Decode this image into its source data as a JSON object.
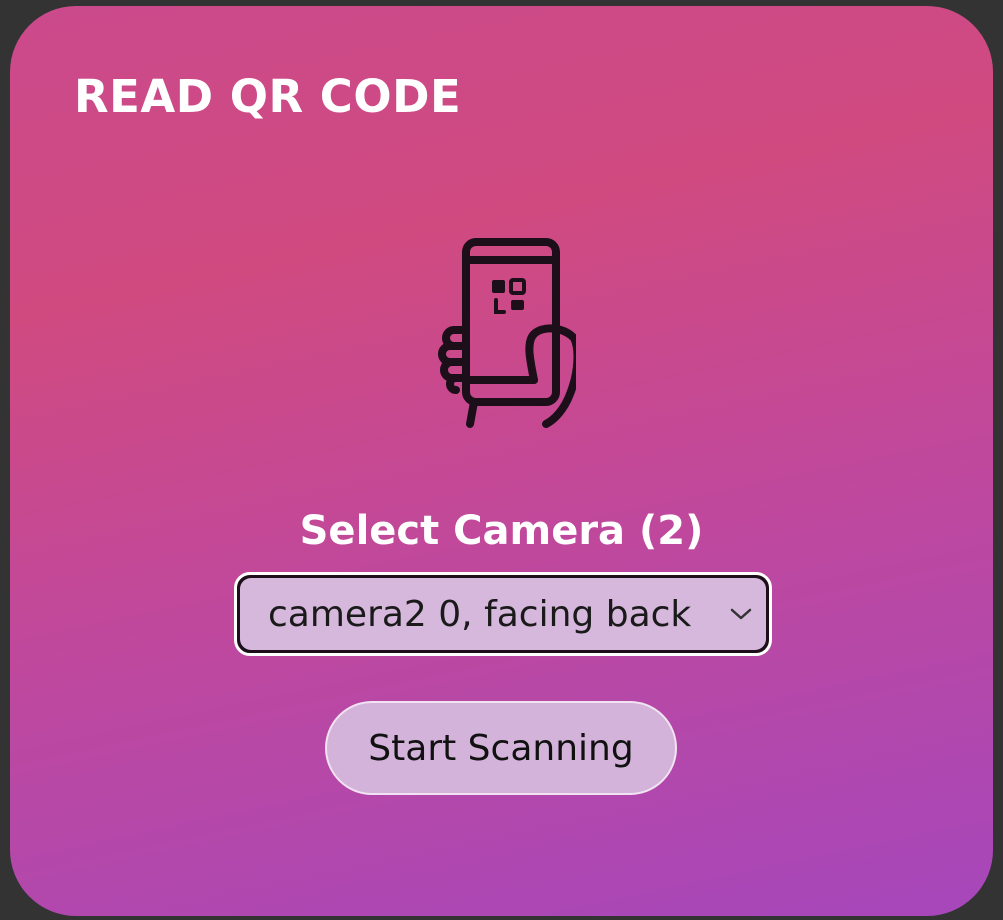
{
  "reader": {
    "title": "READ QR CODE",
    "illustration_icon": "hand-holding-phone-qr-icon",
    "camera_label": "Select Camera (2)",
    "camera_select": {
      "selected": "camera2 0, facing back",
      "options": [
        "camera2 0, facing back"
      ]
    },
    "start_button_label": "Start Scanning"
  },
  "colors": {
    "background_outer": "#333333",
    "card_gradient_top": "#cb4a8c",
    "card_gradient_bottom": "#a647bb",
    "control_fill": "#d4b3db",
    "icon_stroke": "#1c0f1a"
  }
}
